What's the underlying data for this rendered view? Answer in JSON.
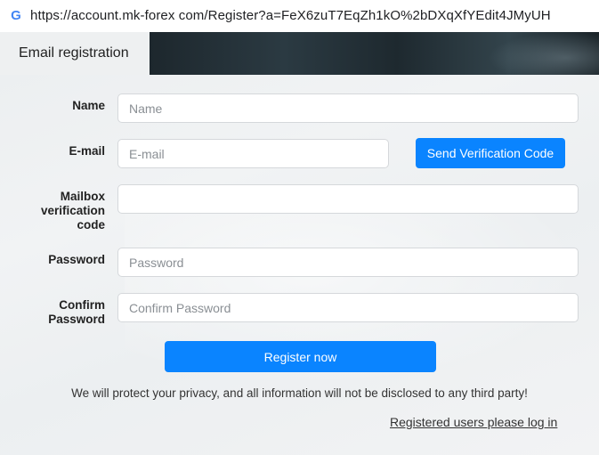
{
  "browser": {
    "url": "https://account.mk-forex com/Register?a=FeX6zuT7EqZh1kO%2bDXqXfYEdit4JMyUH",
    "favicon_icon": "google-g-icon"
  },
  "header": {
    "tab_label": "Email registration"
  },
  "form": {
    "name": {
      "label": "Name",
      "placeholder": "Name"
    },
    "email": {
      "label": "E-mail",
      "placeholder": "E-mail"
    },
    "send_code_label": "Send Verification Code",
    "verification": {
      "label_line1": "Mailbox",
      "label_line2": "verification",
      "label_line3": "code",
      "placeholder": ""
    },
    "password": {
      "label": "Password",
      "placeholder": "Password"
    },
    "confirm": {
      "label_line1": "Confirm",
      "label_line2": "Password",
      "placeholder": "Confirm Password"
    },
    "register_label": "Register now"
  },
  "footer": {
    "privacy_text": "We will protect your privacy, and all information will not be disclosed to any third party!",
    "login_link": "Registered users please log in"
  },
  "colors": {
    "accent": "#0a84ff"
  }
}
